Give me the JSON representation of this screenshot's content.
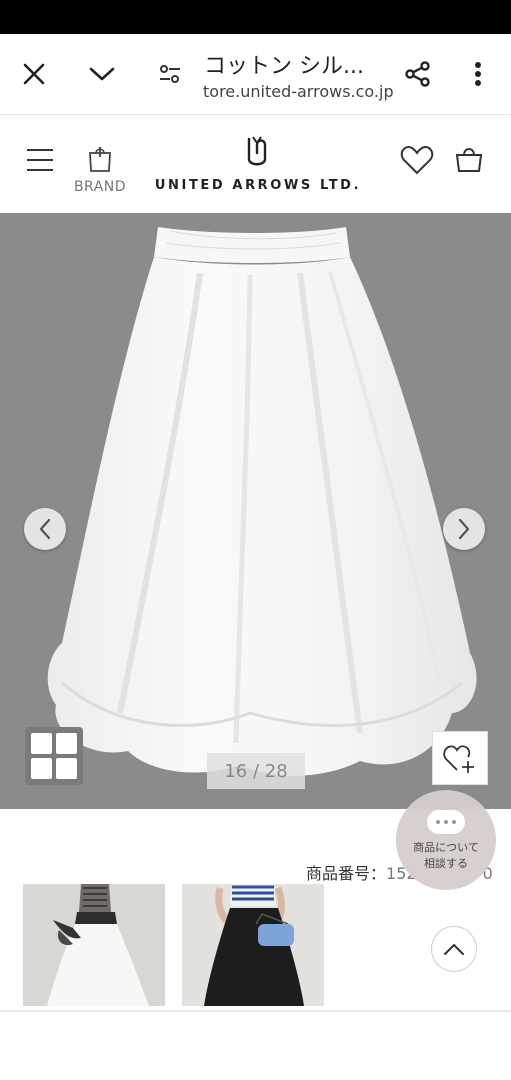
{
  "browser": {
    "title": "コットン シル...",
    "url": "tore.united-arrows.co.jp"
  },
  "header": {
    "brand_label": "BRAND",
    "logo_text": "UNITED ARROWS LTD."
  },
  "gallery": {
    "counter": "16 / 28"
  },
  "product": {
    "number_label": "商品番号：",
    "number_value_visible": "152",
    "number_value_trailing": "0"
  },
  "chat": {
    "line1": "商品について",
    "line2": "相談する"
  },
  "icons": {
    "close": "close-icon",
    "chevron": "chevron-down-icon",
    "tune": "tune-icon",
    "share": "share-icon",
    "more": "more-vert-icon",
    "menu": "hamburger-icon",
    "brand": "shopping-bag-icon",
    "favorite": "heart-icon",
    "cart": "cart-icon",
    "prev": "chevron-left-icon",
    "next": "chevron-right-icon",
    "grid": "grid-icon",
    "favorite_add": "heart-plus-icon",
    "chat": "chat-icon",
    "scroll_top": "chevron-up-icon"
  },
  "colors": {
    "image_background": "#8b8b8d",
    "skirt": "#f6f6f4",
    "status_bar": "#000000"
  }
}
